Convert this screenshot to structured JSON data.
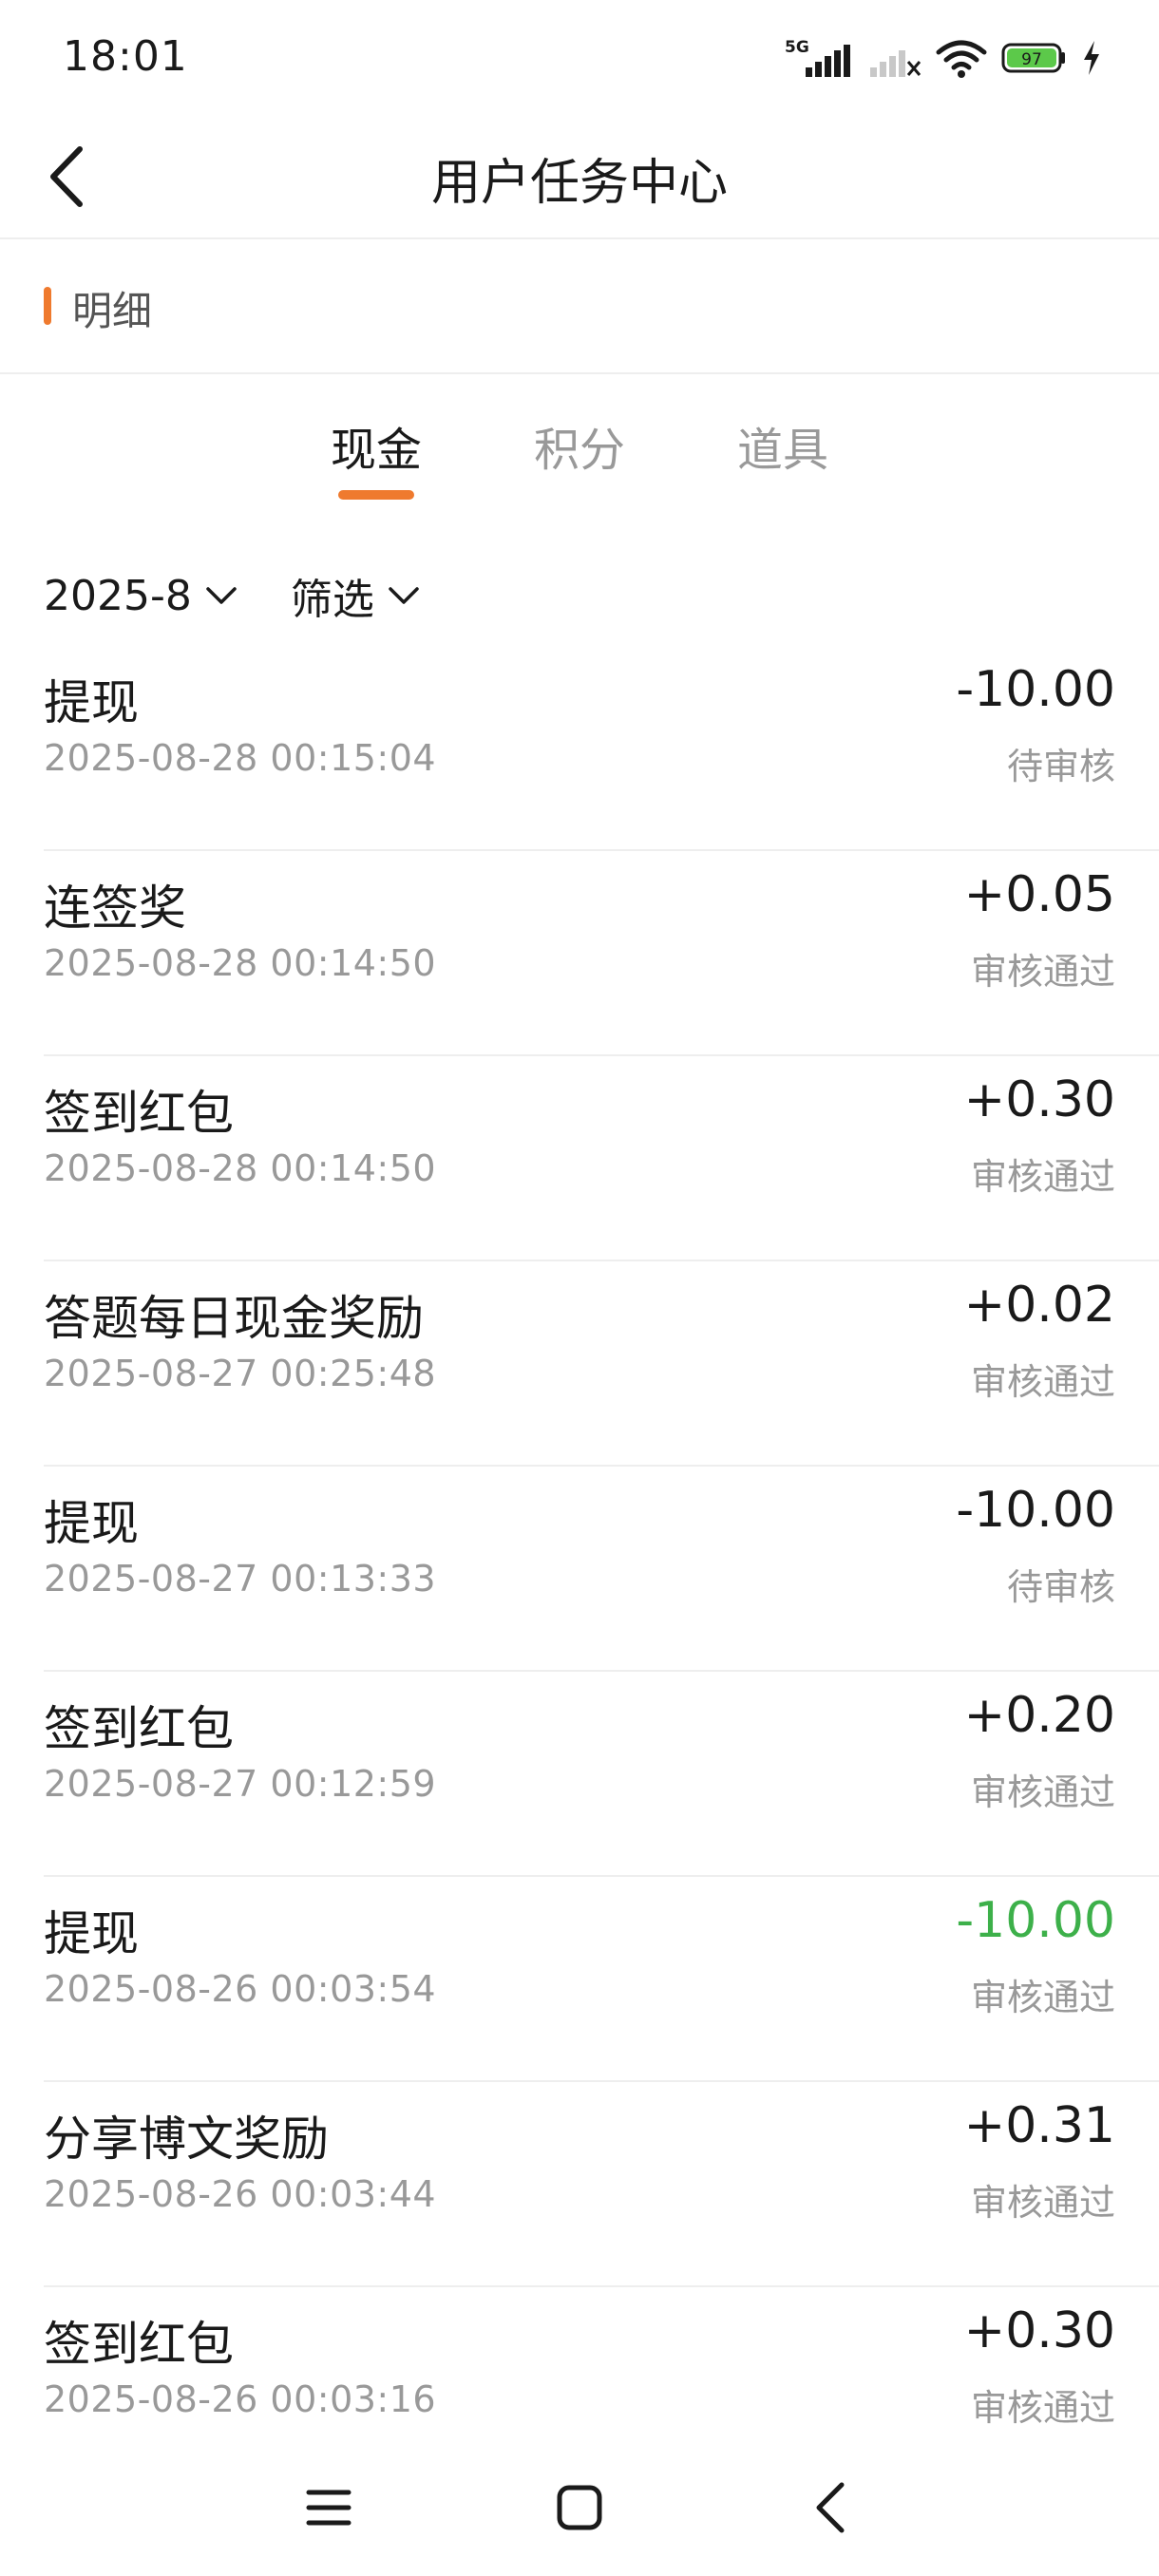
{
  "status_bar": {
    "time": "18:01",
    "network_label": "5G",
    "battery": "97"
  },
  "header": {
    "title": "用户任务中心"
  },
  "section": {
    "label": "明细"
  },
  "tabs": [
    {
      "label": "现金",
      "active": true
    },
    {
      "label": "积分",
      "active": false
    },
    {
      "label": "道具",
      "active": false
    }
  ],
  "filters": {
    "month": "2025-8",
    "filter_label": "筛选"
  },
  "records": [
    {
      "title": "提现",
      "time": "2025-08-28 00:15:04",
      "amount": "-10.00",
      "status": "待审核",
      "amount_color": "default"
    },
    {
      "title": "连签奖",
      "time": "2025-08-28 00:14:50",
      "amount": "+0.05",
      "status": "审核通过",
      "amount_color": "default"
    },
    {
      "title": "签到红包",
      "time": "2025-08-28 00:14:50",
      "amount": "+0.30",
      "status": "审核通过",
      "amount_color": "default"
    },
    {
      "title": "答题每日现金奖励",
      "time": "2025-08-27 00:25:48",
      "amount": "+0.02",
      "status": "审核通过",
      "amount_color": "default"
    },
    {
      "title": "提现",
      "time": "2025-08-27 00:13:33",
      "amount": "-10.00",
      "status": "待审核",
      "amount_color": "default"
    },
    {
      "title": "签到红包",
      "time": "2025-08-27 00:12:59",
      "amount": "+0.20",
      "status": "审核通过",
      "amount_color": "default"
    },
    {
      "title": "提现",
      "time": "2025-08-26 00:03:54",
      "amount": "-10.00",
      "status": "审核通过",
      "amount_color": "green"
    },
    {
      "title": "分享博文奖励",
      "time": "2025-08-26 00:03:44",
      "amount": "+0.31",
      "status": "审核通过",
      "amount_color": "default"
    },
    {
      "title": "签到红包",
      "time": "2025-08-26 00:03:16",
      "amount": "+0.30",
      "status": "审核通过",
      "amount_color": "default"
    }
  ],
  "colors": {
    "accent": "#ef7a2e",
    "success": "#3db04a",
    "muted": "#999999"
  },
  "icons": {
    "back": "chevron-left-icon",
    "dropdown": "chevron-down-icon",
    "nav_menu": "menu-icon",
    "nav_home": "square-icon",
    "nav_back": "back-icon"
  }
}
